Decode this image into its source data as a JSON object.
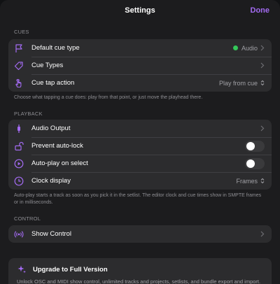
{
  "nav": {
    "title": "Settings",
    "done_label": "Done"
  },
  "colors": {
    "accent": "#a36bf2",
    "status_green": "#34c759",
    "sheet_bg": "#1c1c1e",
    "group_bg": "#2c2c2e"
  },
  "cues": {
    "header": "CUES",
    "rows": [
      {
        "label": "Default cue type",
        "value": "Audio",
        "icon": "flag-icon"
      },
      {
        "label": "Cue Types",
        "icon": "tag-icon"
      },
      {
        "label": "Cue tap action",
        "value": "Play from cue",
        "icon": "tap-hand-icon"
      }
    ],
    "footer": "Choose what tapping a cue does: play from that point, or just move the playhead there."
  },
  "playback": {
    "header": "PLAYBACK",
    "rows": [
      {
        "label": "Audio Output",
        "icon": "audio-output-icon"
      },
      {
        "label": "Prevent auto-lock",
        "icon": "lock-open-icon",
        "toggle_on": false
      },
      {
        "label": "Auto-play on select",
        "icon": "play-circle-icon",
        "toggle_on": false
      },
      {
        "label": "Clock display",
        "value": "Frames",
        "icon": "clock-icon"
      }
    ],
    "footer": "Auto-play starts a track as soon as you pick it in the setlist. The editor clock and cue times show in SMPTE frames or in milliseconds."
  },
  "control": {
    "header": "CONTROL",
    "rows": [
      {
        "label": "Show Control",
        "icon": "broadcast-icon"
      }
    ]
  },
  "upgrade": {
    "title": "Upgrade to Full Version",
    "text": "Unlock OSC and MIDI show control, unlimited tracks and projects, setlists, and bundle export and import.",
    "icon": "sparkles-icon"
  }
}
